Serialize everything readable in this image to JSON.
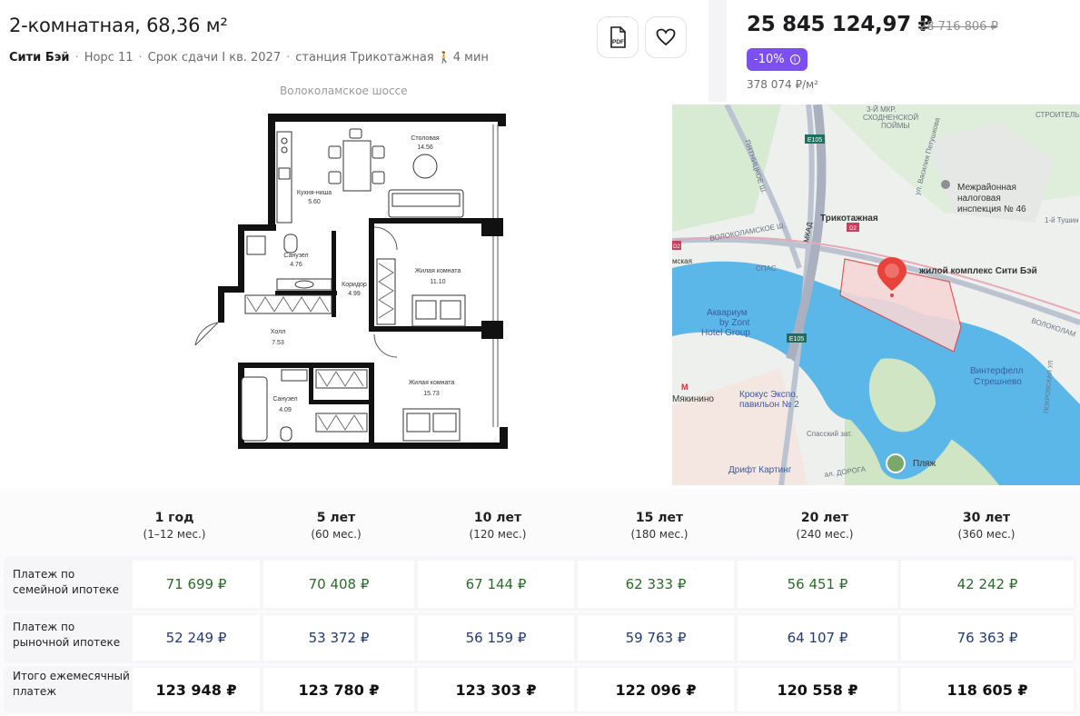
{
  "listing": {
    "title": "2-комнатная, 68,36 м²",
    "developer": "Сити Бэй",
    "building": "Норс 11",
    "delivery": "Срок сдачи I кв. 2027",
    "station": "станция Трикотажная",
    "walk_time": "4 мин",
    "pdf_label": "PDF"
  },
  "price": {
    "current": "25 845 124,97 ₽",
    "old": "28 716 806 ₽",
    "discount": "-10%",
    "per_m2": "378 074 ₽/м²"
  },
  "plan": {
    "street": "Волоколамское шоссе",
    "rooms": [
      {
        "name": "Столовая",
        "area": "14.56"
      },
      {
        "name": "Кухня-ниша",
        "area": "5.60"
      },
      {
        "name": "Санузел",
        "area": "4.76"
      },
      {
        "name": "Коридор",
        "area": "4.99"
      },
      {
        "name": "Жилая комната",
        "area": "11.10"
      },
      {
        "name": "Холл",
        "area": "7.53"
      },
      {
        "name": "Санузел",
        "area": "4.09"
      },
      {
        "name": "Жилая комната",
        "area": "15.73"
      }
    ]
  },
  "map": {
    "labels": {
      "mkr": "3-Й МКР.",
      "skhod": "СХОДНЕНСКОЙ",
      "poimy": "ПОЙМЫ",
      "e105a": "E105",
      "e105b": "E105",
      "petush": "ул. Василия Петушкова",
      "stroit": "СТРОИТЕЛЬН",
      "tax1": "Межрайонная",
      "tax2": "налоговая",
      "tax3": "инспекция № 46",
      "tushin": "1-й Тушин",
      "mskaya": "мская",
      "pyatn": "ПЯТНИЦКОЕ Ш.",
      "mkad": "МКАД",
      "trikot": "Трикотажная",
      "d2": "D2",
      "d2b": "D2",
      "volok": "ВОЛОКОЛАМСКОЕ Ш.",
      "volok2": "ВОЛОКОЛАМ",
      "spas": "СПАС",
      "complex": "жилой комплекс Сити Бэй",
      "aq1": "Аквариум",
      "aq2": "by Zont",
      "aq3": "Hotel Group",
      "wf1": "Винтерфелл",
      "wf2": "Стрешнево",
      "pokrov": "ПОКРОВСКАЯ УЛ",
      "metro": "М",
      "myak": "Мякинино",
      "kr1": "Крокус Экспо,",
      "kr2": "павильон № 2",
      "spassky": "Спасский зат.",
      "drift": "Дрифт Картинг",
      "doroga": "ал. ДОРОГА",
      "beach": "Пляж"
    }
  },
  "mortgage": {
    "columns": [
      {
        "years": "1 год",
        "months": "(1–12 мес.)"
      },
      {
        "years": "5 лет",
        "months": "(60 мес.)"
      },
      {
        "years": "10 лет",
        "months": "(120 мес.)"
      },
      {
        "years": "15 лет",
        "months": "(180 мес.)"
      },
      {
        "years": "20 лет",
        "months": "(240 мес.)"
      },
      {
        "years": "30 лет",
        "months": "(360 мес.)"
      }
    ],
    "rows": [
      {
        "label": "Платеж по семейной ипотеке",
        "values": [
          "71 699 ₽",
          "70 408 ₽",
          "67 144 ₽",
          "62 333 ₽",
          "56 451 ₽",
          "42 242 ₽"
        ]
      },
      {
        "label": "Платеж по рыночной ипотеке",
        "values": [
          "52 249 ₽",
          "53 372 ₽",
          "56 159 ₽",
          "59 763 ₽",
          "64 107 ₽",
          "76 363 ₽"
        ]
      },
      {
        "label": "Итого ежемесячный платеж",
        "values": [
          "123 948 ₽",
          "123 780 ₽",
          "123 303 ₽",
          "122 096 ₽",
          "120 558 ₽",
          "118 605 ₽"
        ]
      }
    ]
  }
}
